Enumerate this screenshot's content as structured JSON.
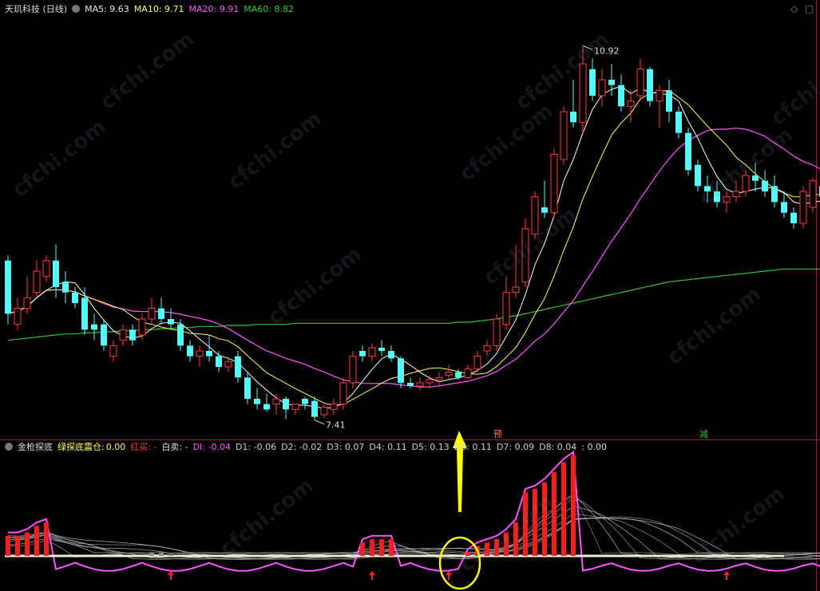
{
  "main_header": {
    "title": "天玑科技 (日线)",
    "ma5_label": "MA5: 9.63",
    "ma10_label": "MA10: 9.71",
    "ma20_label": "MA20: 9.91",
    "ma60_label": "MA60: 8.82"
  },
  "indicator_header": {
    "name": "金枪探底",
    "green_label": "绿探底震仓:",
    "green_value": "0.00",
    "red_buy": "红买: -",
    "white_sell": "白卖: -",
    "di": "DI: -0.04",
    "d_values": [
      "D1: -0.06",
      "D2: -0.02",
      "D3: 0.07",
      "D4: 0.11",
      "D5: 0.13",
      "D6: 0.11",
      "D7: 0.09",
      "D8: 0.04"
    ],
    "tail": ": 0.00"
  },
  "markers": {
    "pre": "预",
    "reduce": "减"
  },
  "watermark": "cfchi.com",
  "colors": {
    "up": "#ff3c3c",
    "down": "#54fcfc",
    "ma5": "#ffffff",
    "ma10": "#ffff54",
    "ma20": "#ff54ff",
    "ma60": "#2ec82e",
    "bar": "#ff1c1c",
    "annotation": "#ffff00"
  },
  "chart_data": {
    "type": "candlestick",
    "y_axis_visible": false,
    "annotations": {
      "high": "10.92",
      "low": "7.41"
    },
    "candles": [
      {
        "o": 8.9,
        "h": 8.95,
        "l": 8.3,
        "c": 8.4
      },
      {
        "o": 8.3,
        "h": 8.55,
        "l": 8.25,
        "c": 8.45
      },
      {
        "o": 8.45,
        "h": 8.75,
        "l": 8.4,
        "c": 8.55
      },
      {
        "o": 8.6,
        "h": 8.9,
        "l": 8.55,
        "c": 8.8
      },
      {
        "o": 8.75,
        "h": 8.95,
        "l": 8.7,
        "c": 8.9
      },
      {
        "o": 8.9,
        "h": 9.05,
        "l": 8.55,
        "c": 8.65
      },
      {
        "o": 8.7,
        "h": 8.8,
        "l": 8.5,
        "c": 8.6
      },
      {
        "o": 8.6,
        "h": 8.65,
        "l": 8.45,
        "c": 8.5
      },
      {
        "o": 8.55,
        "h": 8.65,
        "l": 8.2,
        "c": 8.25
      },
      {
        "o": 8.3,
        "h": 8.4,
        "l": 8.15,
        "c": 8.25
      },
      {
        "o": 8.3,
        "h": 8.35,
        "l": 8.05,
        "c": 8.1
      },
      {
        "o": 8.0,
        "h": 8.15,
        "l": 7.95,
        "c": 8.1
      },
      {
        "o": 8.15,
        "h": 8.3,
        "l": 8.1,
        "c": 8.25
      },
      {
        "o": 8.25,
        "h": 8.3,
        "l": 8.1,
        "c": 8.15
      },
      {
        "o": 8.2,
        "h": 8.4,
        "l": 8.15,
        "c": 8.35
      },
      {
        "o": 8.35,
        "h": 8.55,
        "l": 8.3,
        "c": 8.45
      },
      {
        "o": 8.45,
        "h": 8.55,
        "l": 8.3,
        "c": 8.35
      },
      {
        "o": 8.35,
        "h": 8.45,
        "l": 8.25,
        "c": 8.3
      },
      {
        "o": 8.3,
        "h": 8.35,
        "l": 8.05,
        "c": 8.1
      },
      {
        "o": 8.1,
        "h": 8.15,
        "l": 7.95,
        "c": 8.0
      },
      {
        "o": 8.0,
        "h": 8.1,
        "l": 7.9,
        "c": 8.05
      },
      {
        "o": 8.05,
        "h": 8.2,
        "l": 7.95,
        "c": 8.0
      },
      {
        "o": 8.0,
        "h": 8.05,
        "l": 7.85,
        "c": 7.9
      },
      {
        "o": 7.9,
        "h": 8.0,
        "l": 7.85,
        "c": 7.95
      },
      {
        "o": 8.0,
        "h": 8.05,
        "l": 7.75,
        "c": 7.8
      },
      {
        "o": 7.8,
        "h": 7.85,
        "l": 7.55,
        "c": 7.6
      },
      {
        "o": 7.6,
        "h": 7.7,
        "l": 7.5,
        "c": 7.55
      },
      {
        "o": 7.55,
        "h": 7.65,
        "l": 7.48,
        "c": 7.5
      },
      {
        "o": 7.55,
        "h": 7.65,
        "l": 7.45,
        "c": 7.6
      },
      {
        "o": 7.6,
        "h": 7.62,
        "l": 7.41,
        "c": 7.5
      },
      {
        "o": 7.5,
        "h": 7.55,
        "l": 7.45,
        "c": 7.55
      },
      {
        "o": 7.6,
        "h": 7.62,
        "l": 7.5,
        "c": 7.55
      },
      {
        "o": 7.58,
        "h": 7.62,
        "l": 7.4,
        "c": 7.43
      },
      {
        "o": 7.45,
        "h": 7.55,
        "l": 7.42,
        "c": 7.52
      },
      {
        "o": 7.5,
        "h": 7.6,
        "l": 7.45,
        "c": 7.55
      },
      {
        "o": 7.55,
        "h": 7.8,
        "l": 7.5,
        "c": 7.75
      },
      {
        "o": 7.75,
        "h": 8.05,
        "l": 7.7,
        "c": 8.0
      },
      {
        "o": 8.05,
        "h": 8.1,
        "l": 7.95,
        "c": 8.0
      },
      {
        "o": 8.0,
        "h": 8.12,
        "l": 7.95,
        "c": 8.08
      },
      {
        "o": 8.08,
        "h": 8.15,
        "l": 8.0,
        "c": 8.05
      },
      {
        "o": 8.05,
        "h": 8.1,
        "l": 7.95,
        "c": 7.98
      },
      {
        "o": 7.98,
        "h": 8.0,
        "l": 7.7,
        "c": 7.75
      },
      {
        "o": 7.75,
        "h": 7.8,
        "l": 7.7,
        "c": 7.72
      },
      {
        "o": 7.72,
        "h": 7.8,
        "l": 7.68,
        "c": 7.75
      },
      {
        "o": 7.75,
        "h": 7.82,
        "l": 7.7,
        "c": 7.78
      },
      {
        "o": 7.78,
        "h": 7.85,
        "l": 7.72,
        "c": 7.8
      },
      {
        "o": 7.82,
        "h": 7.92,
        "l": 7.78,
        "c": 7.85
      },
      {
        "o": 7.85,
        "h": 7.88,
        "l": 7.78,
        "c": 7.8
      },
      {
        "o": 7.8,
        "h": 7.92,
        "l": 7.78,
        "c": 7.88
      },
      {
        "o": 7.88,
        "h": 8.05,
        "l": 7.85,
        "c": 8.0
      },
      {
        "o": 8.05,
        "h": 8.15,
        "l": 8.0,
        "c": 8.1
      },
      {
        "o": 8.1,
        "h": 8.4,
        "l": 8.05,
        "c": 8.35
      },
      {
        "o": 8.3,
        "h": 8.75,
        "l": 8.25,
        "c": 8.6
      },
      {
        "o": 8.6,
        "h": 9.05,
        "l": 8.55,
        "c": 8.65
      },
      {
        "o": 8.7,
        "h": 9.3,
        "l": 8.65,
        "c": 9.2
      },
      {
        "o": 9.15,
        "h": 9.55,
        "l": 9.1,
        "c": 9.5
      },
      {
        "o": 9.4,
        "h": 9.65,
        "l": 9.3,
        "c": 9.35
      },
      {
        "o": 9.35,
        "h": 9.95,
        "l": 9.3,
        "c": 9.9
      },
      {
        "o": 9.85,
        "h": 10.35,
        "l": 9.8,
        "c": 10.3
      },
      {
        "o": 10.3,
        "h": 10.6,
        "l": 10.15,
        "c": 10.2
      },
      {
        "o": 10.2,
        "h": 10.92,
        "l": 10.1,
        "c": 10.75
      },
      {
        "o": 10.7,
        "h": 10.8,
        "l": 10.4,
        "c": 10.45
      },
      {
        "o": 10.45,
        "h": 10.7,
        "l": 10.35,
        "c": 10.6
      },
      {
        "o": 10.6,
        "h": 10.75,
        "l": 10.45,
        "c": 10.55
      },
      {
        "o": 10.55,
        "h": 10.65,
        "l": 10.3,
        "c": 10.35
      },
      {
        "o": 10.35,
        "h": 10.5,
        "l": 10.2,
        "c": 10.4
      },
      {
        "o": 10.45,
        "h": 10.8,
        "l": 10.4,
        "c": 10.7
      },
      {
        "o": 10.7,
        "h": 10.72,
        "l": 10.35,
        "c": 10.4
      },
      {
        "o": 10.4,
        "h": 10.55,
        "l": 10.15,
        "c": 10.5
      },
      {
        "o": 10.5,
        "h": 10.6,
        "l": 10.2,
        "c": 10.3
      },
      {
        "o": 10.3,
        "h": 10.35,
        "l": 10.05,
        "c": 10.1
      },
      {
        "o": 10.1,
        "h": 10.15,
        "l": 9.7,
        "c": 9.75
      },
      {
        "o": 9.8,
        "h": 9.85,
        "l": 9.55,
        "c": 9.6
      },
      {
        "o": 9.6,
        "h": 9.7,
        "l": 9.45,
        "c": 9.55
      },
      {
        "o": 9.55,
        "h": 9.65,
        "l": 9.4,
        "c": 9.45
      },
      {
        "o": 9.45,
        "h": 9.55,
        "l": 9.35,
        "c": 9.5
      },
      {
        "o": 9.5,
        "h": 9.65,
        "l": 9.45,
        "c": 9.55
      },
      {
        "o": 9.55,
        "h": 9.75,
        "l": 9.5,
        "c": 9.7
      },
      {
        "o": 9.7,
        "h": 9.82,
        "l": 9.55,
        "c": 9.65
      },
      {
        "o": 9.65,
        "h": 9.75,
        "l": 9.5,
        "c": 9.55
      },
      {
        "o": 9.6,
        "h": 9.7,
        "l": 9.4,
        "c": 9.45
      },
      {
        "o": 9.45,
        "h": 9.55,
        "l": 9.3,
        "c": 9.35
      },
      {
        "o": 9.35,
        "h": 9.4,
        "l": 9.2,
        "c": 9.25
      },
      {
        "o": 9.25,
        "h": 9.6,
        "l": 9.2,
        "c": 9.55
      },
      {
        "o": 9.4,
        "h": 9.68,
        "l": 9.35,
        "c": 9.65
      },
      {
        "o": 9.6,
        "h": 9.65,
        "l": 9.4,
        "c": 9.5
      }
    ],
    "ma60": [
      8.15,
      8.16,
      8.17,
      8.18,
      8.19,
      8.2,
      8.21,
      8.21,
      8.22,
      8.22,
      8.23,
      8.23,
      8.24,
      8.24,
      8.25,
      8.25,
      8.26,
      8.26,
      8.27,
      8.27,
      8.28,
      8.28,
      8.28,
      8.29,
      8.29,
      8.29,
      8.3,
      8.3,
      8.3,
      8.3,
      8.31,
      8.31,
      8.31,
      8.31,
      8.31,
      8.31,
      8.31,
      8.31,
      8.31,
      8.31,
      8.31,
      8.31,
      8.31,
      8.31,
      8.31,
      8.31,
      8.31,
      8.32,
      8.32,
      8.33,
      8.34,
      8.35,
      8.37,
      8.38,
      8.4,
      8.42,
      8.44,
      8.46,
      8.48,
      8.5,
      8.52,
      8.54,
      8.56,
      8.58,
      8.6,
      8.62,
      8.64,
      8.66,
      8.68,
      8.7,
      8.71,
      8.72,
      8.73,
      8.74,
      8.75,
      8.76,
      8.77,
      8.78,
      8.79,
      8.8,
      8.81,
      8.82,
      8.82,
      8.82,
      8.82,
      8.82,
      8.82
    ],
    "indicator": {
      "bars": [
        {
          "i": 0,
          "v": 0.06
        },
        {
          "i": 1,
          "v": 0.06
        },
        {
          "i": 2,
          "v": 0.07
        },
        {
          "i": 3,
          "v": 0.09
        },
        {
          "i": 4,
          "v": 0.1
        },
        {
          "i": 37,
          "v": 0.04
        },
        {
          "i": 38,
          "v": 0.05
        },
        {
          "i": 39,
          "v": 0.05
        },
        {
          "i": 40,
          "v": 0.05
        },
        {
          "i": 48,
          "v": 0.01
        },
        {
          "i": 49,
          "v": 0.03
        },
        {
          "i": 50,
          "v": 0.04
        },
        {
          "i": 51,
          "v": 0.05
        },
        {
          "i": 52,
          "v": 0.07
        },
        {
          "i": 53,
          "v": 0.1
        },
        {
          "i": 54,
          "v": 0.19
        },
        {
          "i": 55,
          "v": 0.2
        },
        {
          "i": 56,
          "v": 0.22
        },
        {
          "i": 57,
          "v": 0.25
        },
        {
          "i": 58,
          "v": 0.28
        },
        {
          "i": 59,
          "v": 0.3
        }
      ],
      "green_bars": [
        {
          "i": 15,
          "v": 0.01
        },
        {
          "i": 16,
          "v": 0.01
        },
        {
          "i": 17,
          "v": 0.005
        }
      ],
      "up_arrows": [
        17,
        38,
        46,
        75
      ],
      "circled_index": 47
    }
  }
}
